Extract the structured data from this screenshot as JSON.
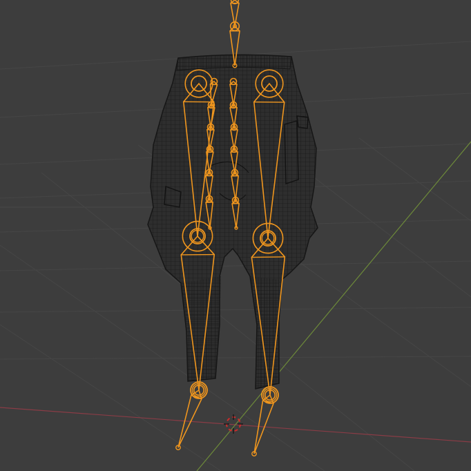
{
  "viewport": {
    "background_color": "#3d3d3d",
    "grid_color": "#464646",
    "x_axis_color": "#8a3c46",
    "y_axis_color": "#6d8a3a",
    "mesh_fill_color": "#2e2e2e",
    "mesh_wire_color": "#161616",
    "armature_color": "#f0961e",
    "cursor_colors": [
      "#d02b2b",
      "#f2f2f2"
    ]
  },
  "scene": {
    "objects": [
      {
        "name": "pants-mesh",
        "icon": "wireframe-mesh-icon"
      },
      {
        "name": "armature",
        "icon": "armature-bones-icon"
      },
      {
        "name": "3d-cursor",
        "icon": "3d-cursor-icon"
      }
    ]
  }
}
